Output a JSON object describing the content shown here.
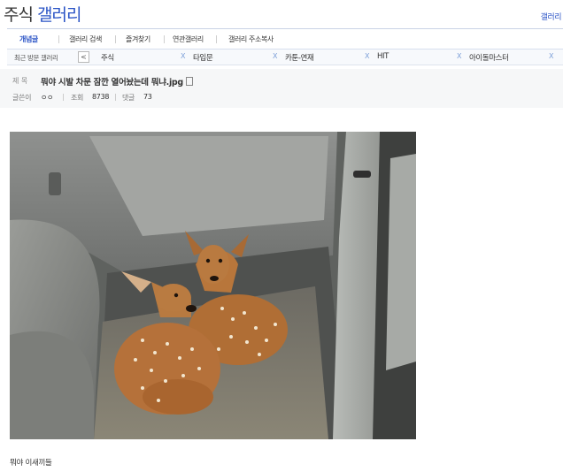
{
  "header": {
    "title_main": "주식",
    "title_accent": "갤러리",
    "right_link": "갤러리"
  },
  "nav": {
    "items": [
      "개념글",
      "갤러리 검색",
      "즐겨찾기",
      "연관갤러리",
      "갤러리 주소복사"
    ]
  },
  "recent": {
    "label": "최근 방문 갤러리",
    "arrow": "<",
    "tabs": [
      "주식",
      "타입문",
      "카툰-연재",
      "HIT",
      "아이돌마스터"
    ],
    "close_glyph": "X"
  },
  "post": {
    "title_label": "제 목",
    "title": "뭐야 시발 차문 잠깐 열어놨는데 뭐냐.jpg",
    "author_label": "글쓴이",
    "author": "ㅇㅇ",
    "views_label": "조회",
    "views": "8738",
    "comments_label": "댓글",
    "comments": "73"
  },
  "body": {
    "caption": "뭐야 이새끼들"
  },
  "colors": {
    "accent": "#2b54c6",
    "nav_border": "#c9d3e6",
    "header_bg": "#f6f7f8"
  }
}
